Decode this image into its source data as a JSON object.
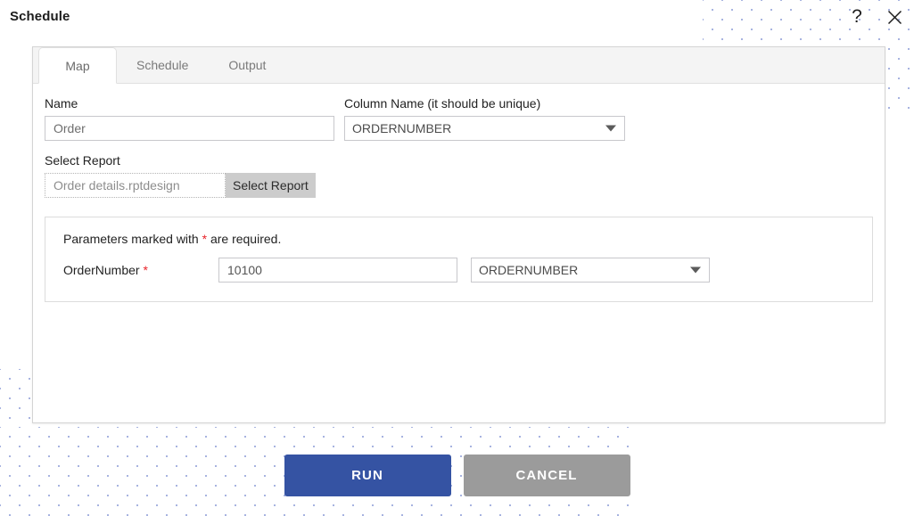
{
  "window": {
    "title": "Schedule",
    "help_icon": "question-mark-icon",
    "close_icon": "close-icon"
  },
  "tabs": [
    {
      "label": "Map",
      "active": true
    },
    {
      "label": "Schedule",
      "active": false
    },
    {
      "label": "Output",
      "active": false
    }
  ],
  "map_tab": {
    "name_label": "Name",
    "name_value": "Order",
    "name_placeholder": "Order",
    "column_name_label": "Column Name (it should be unique)",
    "column_name_value": "ORDERNUMBER",
    "column_name_options": [
      "ORDERNUMBER"
    ],
    "select_report_label": "Select Report",
    "select_report_value": "Order details.rptdesign",
    "select_report_placeholder": "Order details.rptdesign",
    "select_report_button": "Select Report",
    "parameters": {
      "note_prefix": "Parameters marked with ",
      "note_star": "*",
      "note_suffix": " are required.",
      "rows": [
        {
          "name": "OrderNumber",
          "required_star": "*",
          "value": "10100",
          "column": "ORDERNUMBER",
          "column_options": [
            "ORDERNUMBER"
          ]
        }
      ]
    }
  },
  "footer": {
    "run_label": "RUN",
    "cancel_label": "CANCEL"
  },
  "colors": {
    "run_button": "#3553a3",
    "cancel_button": "#9b9b9b",
    "required_star": "#e8232a",
    "dot_pattern": "#a7b3e0",
    "tabbar_bg": "#f4f4f4"
  }
}
